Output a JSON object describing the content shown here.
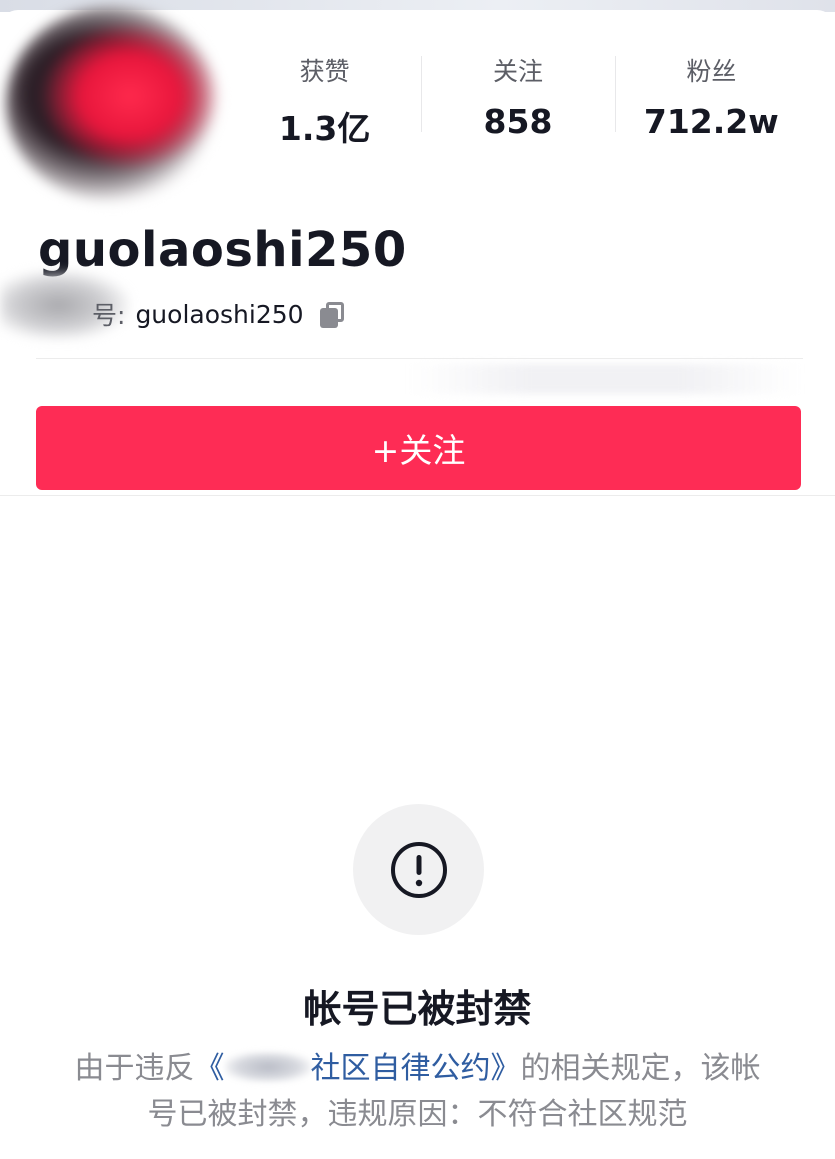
{
  "profile": {
    "username": "guolaoshi250",
    "id_prefix": "号:",
    "id_value": "guolaoshi250"
  },
  "stats": [
    {
      "label": "获赞",
      "value": "1.3亿"
    },
    {
      "label": "关注",
      "value": "858"
    },
    {
      "label": "粉丝",
      "value": "712.2w"
    }
  ],
  "actions": {
    "follow_label": "+关注"
  },
  "ban_notice": {
    "title": "帐号已被封禁",
    "desc_prefix": "由于违反",
    "open_bracket": "《",
    "link_text": "社区自律公约》",
    "desc_mid": "的相关规定，该帐号已被封禁，违规原因：不符合社区规范"
  },
  "colors": {
    "accent": "#fe2c55",
    "link": "#2f5da1",
    "muted_text": "#8a8b91"
  },
  "icons": {
    "copy": "copy-icon",
    "warning": "exclamation-circle-icon"
  }
}
